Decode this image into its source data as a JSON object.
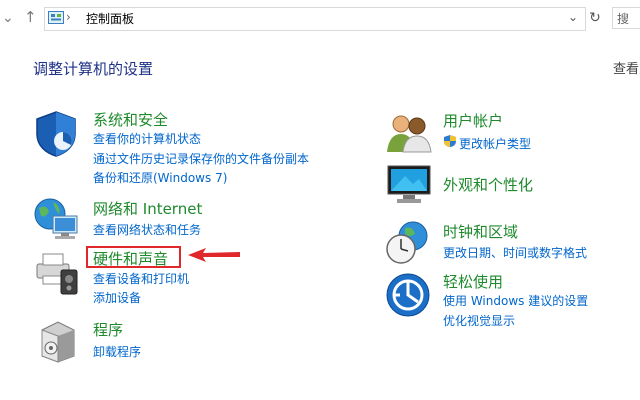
{
  "address_bar": {
    "breadcrumb_icon": "control-panel-icon",
    "breadcrumb_sep": "›",
    "breadcrumb": "控制面板",
    "search_placeholder": "搜"
  },
  "header": {
    "title": "调整计算机的设置",
    "view_by": "查看方式"
  },
  "categories_left": [
    {
      "icon": "shield-icon",
      "title": "系统和安全",
      "links": [
        "查看你的计算机状态",
        "通过文件历史记录保存你的文件备份副本",
        "备份和还原(Windows 7)"
      ]
    },
    {
      "icon": "network-globe-icon",
      "title": "网络和 Internet",
      "links": [
        "查看网络状态和任务"
      ]
    },
    {
      "icon": "printer-speaker-icon",
      "title": "硬件和声音",
      "links": [
        "查看设备和打印机",
        "添加设备"
      ]
    },
    {
      "icon": "programs-box-icon",
      "title": "程序",
      "links": [
        "卸载程序"
      ]
    }
  ],
  "categories_right": [
    {
      "icon": "user-accounts-icon",
      "title": "用户帐户",
      "links": [
        "更改帐户类型"
      ]
    },
    {
      "icon": "monitor-personalization-icon",
      "title": "外观和个性化",
      "links": []
    },
    {
      "icon": "clock-globe-icon",
      "title": "时钟和区域",
      "links": [
        "更改日期、时间或数字格式"
      ]
    },
    {
      "icon": "ease-of-access-icon",
      "title": "轻松使用",
      "links": [
        "使用 Windows 建议的设置",
        "优化视觉显示"
      ]
    }
  ],
  "annotation": {
    "highlight_color": "#e0282b"
  }
}
